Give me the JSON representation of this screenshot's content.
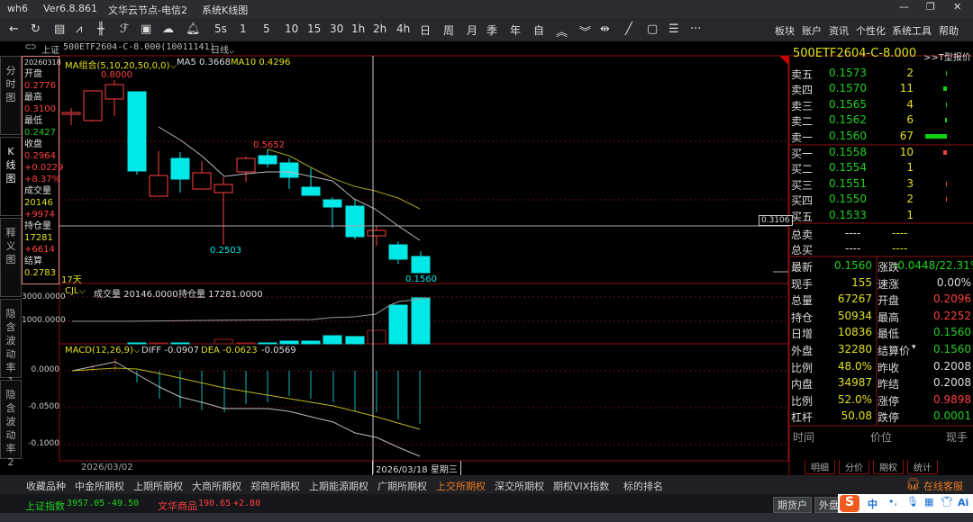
{
  "title": {
    "app": "wh6",
    "version": "Ver6.8.861",
    "server": "文华云节点-电信2",
    "view": "系统K线图"
  },
  "toolbar": {
    "periods": [
      "5s",
      "1",
      "5",
      "10",
      "15",
      "30",
      "1h",
      "2h",
      "4h",
      "日",
      "周",
      "月",
      "季",
      "年",
      "自"
    ],
    "menus": [
      "板块",
      "账户",
      "资讯",
      "个性化",
      "系统工具",
      "帮助"
    ]
  },
  "symbol": {
    "exchange": "上证",
    "code": "500ETF2604-C-8.000(10011141)",
    "period": "日线"
  },
  "left_tabs": [
    "分时图",
    "K线图",
    "释义图",
    "隐含波动率1",
    "隐含波动率2"
  ],
  "info": {
    "date": "20260318",
    "open_label": "开盘",
    "open": "0.2776",
    "high_label": "最高",
    "high": "0.3100",
    "low_label": "最低",
    "low": "0.2427",
    "close_label": "收盘",
    "close": "0.2964",
    "change": "+0.0229",
    "pct": "+8.37%",
    "vol_label": "成交量",
    "vol": "20146",
    "vol_chg": "+9974",
    "oi_label": "持仓量",
    "oi": "17281",
    "oi_chg": "+6614",
    "settle_label": "结算",
    "settle": "0.2783"
  },
  "main": {
    "ma_label": "MA组合(5,10,20,50,0,0)",
    "ma5": "MA5 0.3668",
    "ma10": "MA10 0.4296",
    "high_mark": "0.8000",
    "mid_high": "0.5652",
    "low_mark": "0.2503",
    "last_mark": "0.1560",
    "days": "17天",
    "cross_price": "0.3106"
  },
  "volume": {
    "label": "CJL",
    "vol": "成交量 20146.0000",
    "oi": "持仓量 17281.0000",
    "ticks": [
      "3000.0000",
      "1000.0000"
    ]
  },
  "macd": {
    "label": "MACD(12,26,9)",
    "diff": "DIFF -0.0907",
    "dea": "DEA -0.0623",
    "macd": "-0.0569",
    "ticks": [
      "0.0000",
      "-0.0500",
      "-0.1000"
    ]
  },
  "xaxis": {
    "start": "2026/03/02",
    "cross": "2026/03/18 星期三"
  },
  "quote": {
    "name": "500ETF2604-C-8.000",
    "t_link": ">>T型报价",
    "asks": [
      {
        "l": "卖五",
        "p": "0.1573",
        "v": "2"
      },
      {
        "l": "卖四",
        "p": "0.1570",
        "v": "11"
      },
      {
        "l": "卖三",
        "p": "0.1565",
        "v": "4"
      },
      {
        "l": "卖二",
        "p": "0.1562",
        "v": "6"
      },
      {
        "l": "卖一",
        "p": "0.1560",
        "v": "67"
      }
    ],
    "bids": [
      {
        "l": "买一",
        "p": "0.1558",
        "v": "10"
      },
      {
        "l": "买二",
        "p": "0.1554",
        "v": "1"
      },
      {
        "l": "买三",
        "p": "0.1551",
        "v": "3"
      },
      {
        "l": "买四",
        "p": "0.1550",
        "v": "2"
      },
      {
        "l": "买五",
        "p": "0.1533",
        "v": "1"
      }
    ],
    "total_sell": "总卖",
    "total_buy": "总买",
    "dash": "----",
    "stats": [
      {
        "l": "最新",
        "v": "0.1560",
        "vc": "g",
        "l2": "涨跌",
        "v2": "-0.0448/22.31%",
        "v2c": "g"
      },
      {
        "l": "现手",
        "v": "155",
        "vc": "y",
        "l2": "速涨",
        "v2": "0.00%",
        "v2c": "w"
      },
      {
        "l": "总量",
        "v": "67267",
        "vc": "y",
        "l2": "开盘",
        "v2": "0.2096",
        "v2c": "r"
      },
      {
        "l": "持仓",
        "v": "50934",
        "vc": "y",
        "l2": "最高",
        "v2": "0.2252",
        "v2c": "r"
      },
      {
        "l": "日增",
        "v": "10836",
        "vc": "y",
        "l2": "最低",
        "v2": "0.1560",
        "v2c": "g"
      },
      {
        "l": "外盘",
        "v": "32280",
        "vc": "y",
        "l2": "结算价",
        "v2": "0.1560",
        "v2c": "g"
      },
      {
        "l": "比例",
        "v": "48.0%",
        "vc": "y",
        "l2": "昨收",
        "v2": "0.2008",
        "v2c": "w"
      },
      {
        "l": "内盘",
        "v": "34987",
        "vc": "y",
        "l2": "昨结",
        "v2": "0.2008",
        "v2c": "w"
      },
      {
        "l": "比例",
        "v": "52.0%",
        "vc": "y",
        "l2": "涨停",
        "v2": "0.9898",
        "v2c": "r"
      },
      {
        "l": "杠杆",
        "v": "50.08",
        "vc": "y",
        "l2": "跌停",
        "v2": "0.0001",
        "v2c": "g"
      }
    ],
    "tick_headers": [
      "时间",
      "价位",
      "现手"
    ],
    "bottom_tabs": [
      "明细",
      "分价",
      "期权",
      "统计"
    ]
  },
  "exchange_tabs": [
    "收藏品种",
    "中金所期权",
    "上期所期权",
    "大商所期权",
    "郑商所期权",
    "上期能源期权",
    "广期所期权",
    "上交所期权",
    "深交所期权",
    "期权VIX指数",
    "标的排名"
  ],
  "active_exchange": "上交所期权",
  "service": "在线客服",
  "status": {
    "idx1": "上证指数",
    "idx1_val": "3957.05",
    "idx1_chg": "-49.50",
    "idx2": "文华商品",
    "idx2_val": "190.65",
    "idx2_chg": "+2.80"
  },
  "bottom": {
    "btn1": "期货户",
    "btn2": "外盘",
    "ime": "中"
  },
  "colors": {
    "up": "#ff4040",
    "down": "#00e8e8",
    "ma5": "#bbbbbb",
    "ma10": "#a0a020",
    "border": "#8b1010"
  }
}
